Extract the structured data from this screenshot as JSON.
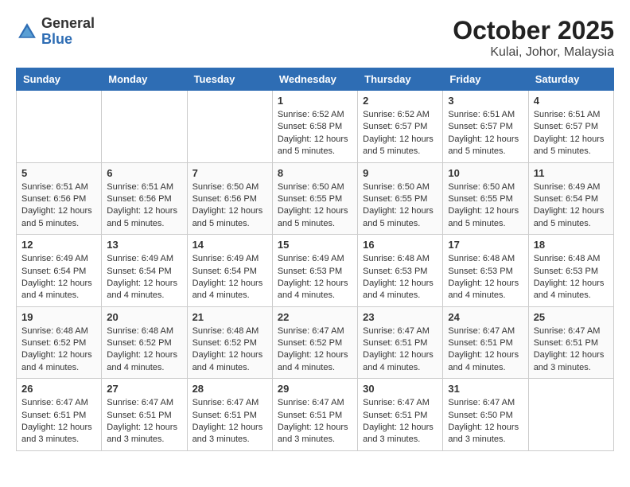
{
  "header": {
    "logo_general": "General",
    "logo_blue": "Blue",
    "month": "October 2025",
    "location": "Kulai, Johor, Malaysia"
  },
  "calendar": {
    "days_of_week": [
      "Sunday",
      "Monday",
      "Tuesday",
      "Wednesday",
      "Thursday",
      "Friday",
      "Saturday"
    ],
    "weeks": [
      [
        {
          "day": "",
          "sunrise": "",
          "sunset": "",
          "daylight": ""
        },
        {
          "day": "",
          "sunrise": "",
          "sunset": "",
          "daylight": ""
        },
        {
          "day": "",
          "sunrise": "",
          "sunset": "",
          "daylight": ""
        },
        {
          "day": "1",
          "sunrise": "Sunrise: 6:52 AM",
          "sunset": "Sunset: 6:58 PM",
          "daylight": "Daylight: 12 hours and 5 minutes."
        },
        {
          "day": "2",
          "sunrise": "Sunrise: 6:52 AM",
          "sunset": "Sunset: 6:57 PM",
          "daylight": "Daylight: 12 hours and 5 minutes."
        },
        {
          "day": "3",
          "sunrise": "Sunrise: 6:51 AM",
          "sunset": "Sunset: 6:57 PM",
          "daylight": "Daylight: 12 hours and 5 minutes."
        },
        {
          "day": "4",
          "sunrise": "Sunrise: 6:51 AM",
          "sunset": "Sunset: 6:57 PM",
          "daylight": "Daylight: 12 hours and 5 minutes."
        }
      ],
      [
        {
          "day": "5",
          "sunrise": "Sunrise: 6:51 AM",
          "sunset": "Sunset: 6:56 PM",
          "daylight": "Daylight: 12 hours and 5 minutes."
        },
        {
          "day": "6",
          "sunrise": "Sunrise: 6:51 AM",
          "sunset": "Sunset: 6:56 PM",
          "daylight": "Daylight: 12 hours and 5 minutes."
        },
        {
          "day": "7",
          "sunrise": "Sunrise: 6:50 AM",
          "sunset": "Sunset: 6:56 PM",
          "daylight": "Daylight: 12 hours and 5 minutes."
        },
        {
          "day": "8",
          "sunrise": "Sunrise: 6:50 AM",
          "sunset": "Sunset: 6:55 PM",
          "daylight": "Daylight: 12 hours and 5 minutes."
        },
        {
          "day": "9",
          "sunrise": "Sunrise: 6:50 AM",
          "sunset": "Sunset: 6:55 PM",
          "daylight": "Daylight: 12 hours and 5 minutes."
        },
        {
          "day": "10",
          "sunrise": "Sunrise: 6:50 AM",
          "sunset": "Sunset: 6:55 PM",
          "daylight": "Daylight: 12 hours and 5 minutes."
        },
        {
          "day": "11",
          "sunrise": "Sunrise: 6:49 AM",
          "sunset": "Sunset: 6:54 PM",
          "daylight": "Daylight: 12 hours and 5 minutes."
        }
      ],
      [
        {
          "day": "12",
          "sunrise": "Sunrise: 6:49 AM",
          "sunset": "Sunset: 6:54 PM",
          "daylight": "Daylight: 12 hours and 4 minutes."
        },
        {
          "day": "13",
          "sunrise": "Sunrise: 6:49 AM",
          "sunset": "Sunset: 6:54 PM",
          "daylight": "Daylight: 12 hours and 4 minutes."
        },
        {
          "day": "14",
          "sunrise": "Sunrise: 6:49 AM",
          "sunset": "Sunset: 6:54 PM",
          "daylight": "Daylight: 12 hours and 4 minutes."
        },
        {
          "day": "15",
          "sunrise": "Sunrise: 6:49 AM",
          "sunset": "Sunset: 6:53 PM",
          "daylight": "Daylight: 12 hours and 4 minutes."
        },
        {
          "day": "16",
          "sunrise": "Sunrise: 6:48 AM",
          "sunset": "Sunset: 6:53 PM",
          "daylight": "Daylight: 12 hours and 4 minutes."
        },
        {
          "day": "17",
          "sunrise": "Sunrise: 6:48 AM",
          "sunset": "Sunset: 6:53 PM",
          "daylight": "Daylight: 12 hours and 4 minutes."
        },
        {
          "day": "18",
          "sunrise": "Sunrise: 6:48 AM",
          "sunset": "Sunset: 6:53 PM",
          "daylight": "Daylight: 12 hours and 4 minutes."
        }
      ],
      [
        {
          "day": "19",
          "sunrise": "Sunrise: 6:48 AM",
          "sunset": "Sunset: 6:52 PM",
          "daylight": "Daylight: 12 hours and 4 minutes."
        },
        {
          "day": "20",
          "sunrise": "Sunrise: 6:48 AM",
          "sunset": "Sunset: 6:52 PM",
          "daylight": "Daylight: 12 hours and 4 minutes."
        },
        {
          "day": "21",
          "sunrise": "Sunrise: 6:48 AM",
          "sunset": "Sunset: 6:52 PM",
          "daylight": "Daylight: 12 hours and 4 minutes."
        },
        {
          "day": "22",
          "sunrise": "Sunrise: 6:47 AM",
          "sunset": "Sunset: 6:52 PM",
          "daylight": "Daylight: 12 hours and 4 minutes."
        },
        {
          "day": "23",
          "sunrise": "Sunrise: 6:47 AM",
          "sunset": "Sunset: 6:51 PM",
          "daylight": "Daylight: 12 hours and 4 minutes."
        },
        {
          "day": "24",
          "sunrise": "Sunrise: 6:47 AM",
          "sunset": "Sunset: 6:51 PM",
          "daylight": "Daylight: 12 hours and 4 minutes."
        },
        {
          "day": "25",
          "sunrise": "Sunrise: 6:47 AM",
          "sunset": "Sunset: 6:51 PM",
          "daylight": "Daylight: 12 hours and 3 minutes."
        }
      ],
      [
        {
          "day": "26",
          "sunrise": "Sunrise: 6:47 AM",
          "sunset": "Sunset: 6:51 PM",
          "daylight": "Daylight: 12 hours and 3 minutes."
        },
        {
          "day": "27",
          "sunrise": "Sunrise: 6:47 AM",
          "sunset": "Sunset: 6:51 PM",
          "daylight": "Daylight: 12 hours and 3 minutes."
        },
        {
          "day": "28",
          "sunrise": "Sunrise: 6:47 AM",
          "sunset": "Sunset: 6:51 PM",
          "daylight": "Daylight: 12 hours and 3 minutes."
        },
        {
          "day": "29",
          "sunrise": "Sunrise: 6:47 AM",
          "sunset": "Sunset: 6:51 PM",
          "daylight": "Daylight: 12 hours and 3 minutes."
        },
        {
          "day": "30",
          "sunrise": "Sunrise: 6:47 AM",
          "sunset": "Sunset: 6:51 PM",
          "daylight": "Daylight: 12 hours and 3 minutes."
        },
        {
          "day": "31",
          "sunrise": "Sunrise: 6:47 AM",
          "sunset": "Sunset: 6:50 PM",
          "daylight": "Daylight: 12 hours and 3 minutes."
        },
        {
          "day": "",
          "sunrise": "",
          "sunset": "",
          "daylight": ""
        }
      ]
    ]
  }
}
